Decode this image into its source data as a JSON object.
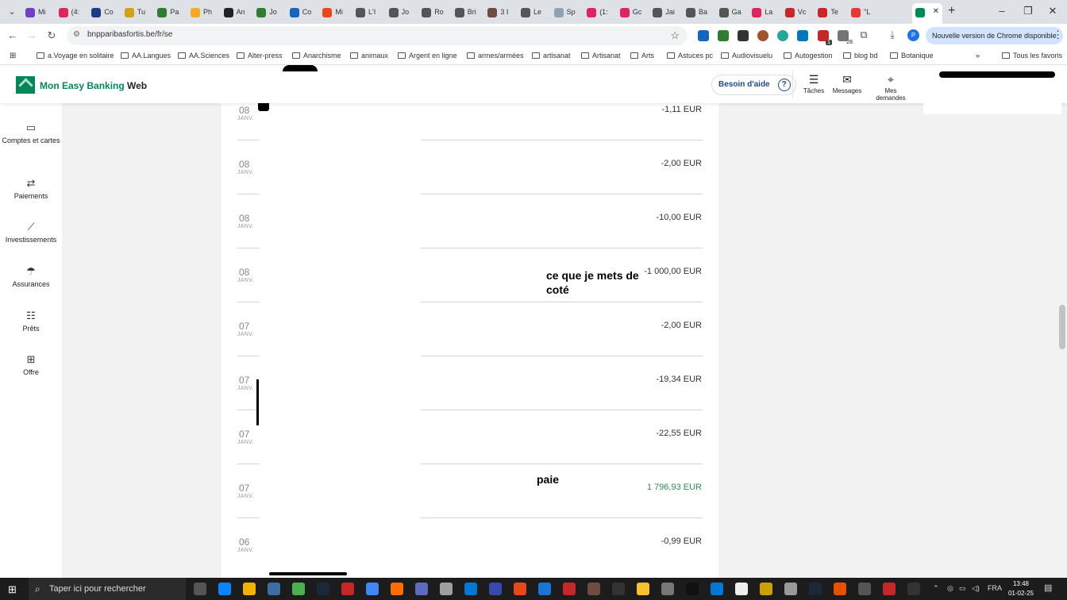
{
  "browser": {
    "tabs": [
      {
        "label": "Mi",
        "color": "#6f42c1"
      },
      {
        "label": "(4:",
        "color": "#e0245e"
      },
      {
        "label": "Co",
        "color": "#1e3a8a"
      },
      {
        "label": "Tu",
        "color": "#d4a017"
      },
      {
        "label": "Pa",
        "color": "#2e7d32"
      },
      {
        "label": "Ph",
        "color": "#f9a825"
      },
      {
        "label": "An",
        "color": "#222222"
      },
      {
        "label": "Jo",
        "color": "#2e7d32"
      },
      {
        "label": "Co",
        "color": "#1565c0"
      },
      {
        "label": "Mi",
        "color": "#e64a19"
      },
      {
        "label": "L'I",
        "color": "#555555"
      },
      {
        "label": "Jo",
        "color": "#555555"
      },
      {
        "label": "Ro",
        "color": "#555555"
      },
      {
        "label": "Bri",
        "color": "#555555"
      },
      {
        "label": "3 I",
        "color": "#6d4c41"
      },
      {
        "label": "Le",
        "color": "#555555"
      },
      {
        "label": "Sp",
        "color": "#90a4ae"
      },
      {
        "label": "(1:",
        "color": "#e0245e"
      },
      {
        "label": "Gc",
        "color": "#e0245e"
      },
      {
        "label": "Jai",
        "color": "#555555"
      },
      {
        "label": "Ba",
        "color": "#555555"
      },
      {
        "label": "Ga",
        "color": "#555555"
      },
      {
        "label": "La",
        "color": "#e0245e"
      },
      {
        "label": "Vc",
        "color": "#c62828"
      },
      {
        "label": "Te",
        "color": "#c62828"
      },
      {
        "label": "\"L",
        "color": "#e53935"
      }
    ],
    "url": "bnpparibasfortis.be/fr/se",
    "update_button": "Nouvelle version de Chrome disponible",
    "bookmarks": [
      "a.Voyage en solitaire",
      "AA.Langues",
      "AA.Sciences",
      "Alter-press",
      "Anarchisme",
      "animaux",
      "Argent en ligne",
      "armes/armées",
      "artisanat",
      "Artisanat",
      "Arts",
      "Astuces pc",
      "Audiovisuelu",
      "Autogestion",
      "blog bd",
      "Botanique"
    ],
    "all_bookmarks": "Tous les favoris",
    "extension_badges": [
      "1",
      "28"
    ],
    "profile_initial": "P"
  },
  "app": {
    "brand_part1": "Mon Easy Banking",
    "brand_part2": " Web",
    "help": "Besoin d'aide",
    "help_icon": "?",
    "header_items": [
      {
        "label": "Tâches",
        "icon": "checklist-icon"
      },
      {
        "label": "Messages",
        "icon": "envelope-icon"
      },
      {
        "label": "Mes demandes",
        "icon": "map-pin-icon"
      }
    ],
    "nav": [
      {
        "label": "Comptes et cartes",
        "icon": "wallet-icon"
      },
      {
        "label": "Paiements",
        "icon": "transfer-icon"
      },
      {
        "label": "Investissements",
        "icon": "chart-icon"
      },
      {
        "label": "Assurances",
        "icon": "umbrella-icon"
      },
      {
        "label": "Prêts",
        "icon": "money-hand-icon"
      },
      {
        "label": "Offre",
        "icon": "gift-icon"
      }
    ]
  },
  "transactions": [
    {
      "day": "08",
      "month": "JANV.",
      "amount": "-1,11 EUR",
      "credit": false
    },
    {
      "day": "08",
      "month": "JANV.",
      "amount": "-2,00 EUR",
      "credit": false
    },
    {
      "day": "08",
      "month": "JANV.",
      "amount": "-10,00 EUR",
      "credit": false
    },
    {
      "day": "08",
      "month": "JANV.",
      "amount": "-1 000,00 EUR",
      "credit": false
    },
    {
      "day": "07",
      "month": "JANV.",
      "amount": "-2,00 EUR",
      "credit": false
    },
    {
      "day": "07",
      "month": "JANV.",
      "amount": "-19,34 EUR",
      "credit": false
    },
    {
      "day": "07",
      "month": "JANV.",
      "amount": "-22,55 EUR",
      "credit": false
    },
    {
      "day": "07",
      "month": "JANV.",
      "amount": "1 796,93 EUR",
      "credit": true
    },
    {
      "day": "06",
      "month": "JANV.",
      "amount": "-0,99 EUR",
      "credit": false
    }
  ],
  "annotations": {
    "savings_note": "ce que je mets de coté",
    "salary_note": "paie"
  },
  "taskbar": {
    "search_placeholder": "Taper ici pour rechercher",
    "language": "FRA",
    "time": "13:48",
    "date": "01-02-25"
  },
  "colors": {
    "brand_green": "#008859",
    "credit_green": "#2e8b57",
    "help_blue": "#1a4a8a"
  }
}
